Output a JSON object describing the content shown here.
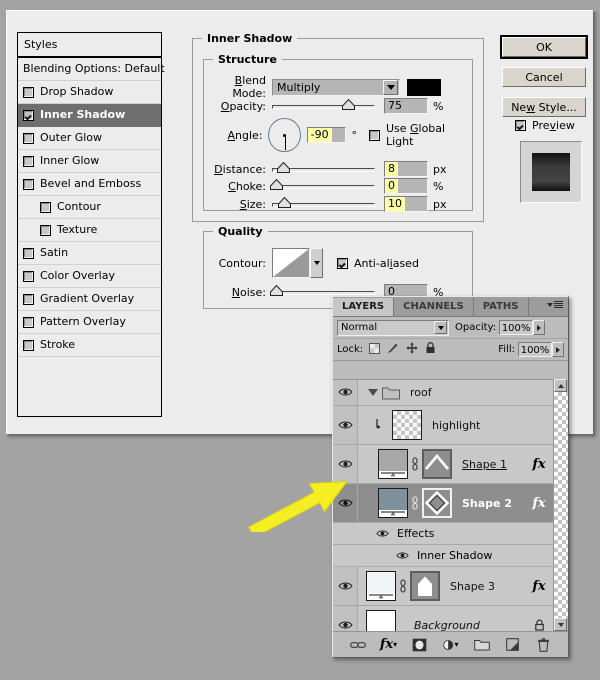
{
  "dialog": {
    "styles_header": "Styles",
    "styles_items": [
      {
        "label": "Blending Options: Default",
        "checkbox": false,
        "has_checkbox": false,
        "indent": false,
        "selected": false
      },
      {
        "label": "Drop Shadow",
        "checkbox": false,
        "has_checkbox": true,
        "indent": false,
        "selected": false
      },
      {
        "label": "Inner Shadow",
        "checkbox": true,
        "has_checkbox": true,
        "indent": false,
        "selected": true
      },
      {
        "label": "Outer Glow",
        "checkbox": false,
        "has_checkbox": true,
        "indent": false,
        "selected": false
      },
      {
        "label": "Inner Glow",
        "checkbox": false,
        "has_checkbox": true,
        "indent": false,
        "selected": false
      },
      {
        "label": "Bevel and Emboss",
        "checkbox": false,
        "has_checkbox": true,
        "indent": false,
        "selected": false
      },
      {
        "label": "Contour",
        "checkbox": false,
        "has_checkbox": true,
        "indent": true,
        "selected": false
      },
      {
        "label": "Texture",
        "checkbox": false,
        "has_checkbox": true,
        "indent": true,
        "selected": false
      },
      {
        "label": "Satin",
        "checkbox": false,
        "has_checkbox": true,
        "indent": false,
        "selected": false
      },
      {
        "label": "Color Overlay",
        "checkbox": false,
        "has_checkbox": true,
        "indent": false,
        "selected": false
      },
      {
        "label": "Gradient Overlay",
        "checkbox": false,
        "has_checkbox": true,
        "indent": false,
        "selected": false
      },
      {
        "label": "Pattern Overlay",
        "checkbox": false,
        "has_checkbox": true,
        "indent": false,
        "selected": false
      },
      {
        "label": "Stroke",
        "checkbox": false,
        "has_checkbox": true,
        "indent": false,
        "selected": false
      }
    ],
    "inner_shadow_title": "Inner Shadow",
    "structure": {
      "title": "Structure",
      "blend_mode_label": "Blend Mode:",
      "blend_mode_value": "Multiply",
      "shadow_color": "#000000",
      "opacity_label": "Opacity:",
      "opacity_value": "75",
      "opacity_unit": "%",
      "angle_label": "Angle:",
      "angle_value": "-90",
      "angle_unit": "°",
      "use_global_light_label": "Use Global Light",
      "use_global_light_checked": false,
      "distance_label": "Distance:",
      "distance_value": "8",
      "distance_unit": "px",
      "choke_label": "Choke:",
      "choke_value": "0",
      "choke_unit": "%",
      "size_label": "Size:",
      "size_value": "10",
      "size_unit": "px"
    },
    "quality": {
      "title": "Quality",
      "contour_label": "Contour:",
      "anti_aliased_label": "Anti-aliased",
      "anti_aliased_checked": true,
      "noise_label": "Noise:",
      "noise_value": "0",
      "noise_unit": "%"
    },
    "buttons": {
      "ok": "OK",
      "cancel": "Cancel",
      "new_style": "New Style...",
      "preview_label": "Preview",
      "preview_checked": true
    }
  },
  "layers_panel": {
    "tabs": [
      {
        "label": "LAYERS",
        "active": true
      },
      {
        "label": "CHANNELS",
        "active": false
      },
      {
        "label": "PATHS",
        "active": false
      }
    ],
    "blend_mode": "Normal",
    "opacity_label": "Opacity:",
    "opacity_value": "100%",
    "lock_label": "Lock:",
    "fill_label": "Fill:",
    "fill_value": "100%",
    "rows": [
      {
        "type": "group",
        "name": "roof",
        "visible": true,
        "expanded": true
      },
      {
        "type": "layer",
        "name": "highlight",
        "visible": true,
        "clipped": true,
        "thumb": "transparent",
        "fx": false,
        "selected": false
      },
      {
        "type": "layer",
        "name": "Shape 1",
        "visible": true,
        "thumb": "gradient-fill",
        "mask": "chevron",
        "fx": true,
        "selected": false,
        "underline": true
      },
      {
        "type": "layer",
        "name": "Shape 2",
        "visible": true,
        "thumb": "blue-fill",
        "mask": "diamond",
        "fx": true,
        "selected": true
      },
      {
        "type": "effects",
        "name": "Effects",
        "visible": true
      },
      {
        "type": "effect-item",
        "name": "Inner Shadow",
        "visible": true
      },
      {
        "type": "layer",
        "name": "Shape 3",
        "visible": true,
        "thumb": "white-fill",
        "mask": "house",
        "fx": true,
        "selected": false
      },
      {
        "type": "layer",
        "name": "Background",
        "visible": true,
        "thumb": "white",
        "locked": true,
        "italic": true,
        "selected": false
      }
    ]
  },
  "annotation": {
    "arrow_color": "#f5ee23",
    "arrow_points_to": "Shape 2"
  }
}
